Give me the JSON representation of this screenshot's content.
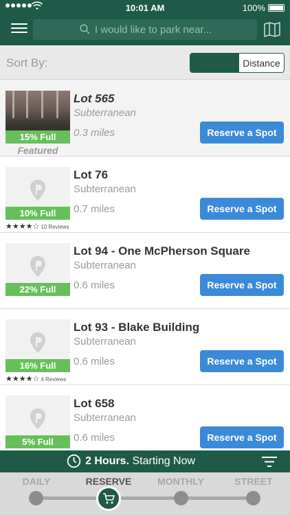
{
  "status_bar": {
    "time": "10:01 AM",
    "battery": "100%"
  },
  "header": {
    "search_placeholder": "I would like to park near..."
  },
  "sort": {
    "label": "Sort By:",
    "option_selected": "",
    "option_other": "Distance"
  },
  "lots": [
    {
      "name": "Lot 565",
      "type": "Subterranean",
      "distance": "0.3 miles",
      "full": "15% Full",
      "featured": "Featured",
      "reserve": "Reserve a Spot",
      "rating": null,
      "reviews": ""
    },
    {
      "name": "Lot 76",
      "type": "Subterranean",
      "distance": "0.7 miles",
      "full": "10% Full",
      "featured": "",
      "reserve": "Reserve a Spot",
      "rating": 4,
      "reviews": "10 Reviews"
    },
    {
      "name": "Lot 94 - One McPherson Square",
      "type": "Subterranean",
      "distance": "0.6 miles",
      "full": "22% Full",
      "featured": "",
      "reserve": "Reserve a Spot",
      "rating": null,
      "reviews": ""
    },
    {
      "name": "Lot 93 - Blake Building",
      "type": "Subterranean",
      "distance": "0.6 miles",
      "full": "16% Full",
      "featured": "",
      "reserve": "Reserve a Spot",
      "rating": 4,
      "reviews": "4 Reviews"
    },
    {
      "name": "Lot 658",
      "type": "Subterranean",
      "distance": "0.6 miles",
      "full": "5% Full",
      "featured": "",
      "reserve": "Reserve a Spot",
      "rating": null,
      "reviews": ""
    }
  ],
  "duration": {
    "hours": "2 Hours.",
    "start": "Starting Now"
  },
  "tabs": [
    {
      "label": "DAILY"
    },
    {
      "label": "RESERVE"
    },
    {
      "label": "MONTHLY"
    },
    {
      "label": "STREET"
    }
  ],
  "colors": {
    "brand_green": "#1f5a48",
    "accent_blue": "#3b8ad8",
    "full_green": "#66c05a"
  },
  "icons": [
    "menu-icon",
    "search-icon",
    "map-icon",
    "parking-pin-icon",
    "clock-icon",
    "filter-icon",
    "cart-icon"
  ]
}
